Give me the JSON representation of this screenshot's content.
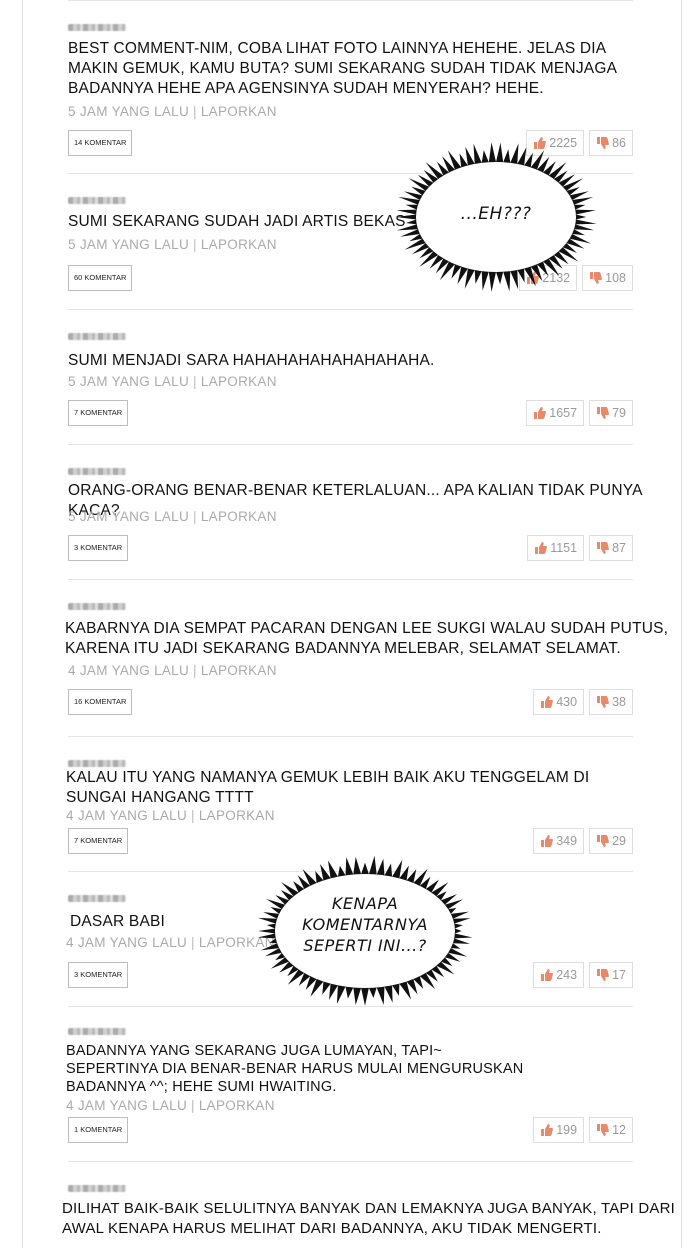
{
  "comments": [
    {
      "text": "BEST COMMENT-NIM, COBA LIHAT FOTO LAINNYA HEHEHE. JELAS DIA MAKIN GEMUK, KAMU BUTA? SUMI SEKARANG SUDAH TIDAK MENJAGA BADANNYA HEHE APA AGENSINYA SUDAH MENYERAH? HEHE.",
      "time": "5 JAM YANG LALU",
      "report": "LAPORKAN",
      "komentar": "14 KOMENTAR",
      "likes": "2225",
      "dislikes": "86"
    },
    {
      "text": "SUMI SEKARANG SUDAH JADI ARTIS BEKAS",
      "time": "5 JAM YANG LALU",
      "report": "LAPORKAN",
      "komentar": "60 KOMENTAR",
      "likes": "2132",
      "dislikes": "108"
    },
    {
      "text": "SUMI MENJADI SARA HAHAHAHAHAHAHAHAHA.",
      "time": "5 JAM YANG LALU",
      "report": "LAPORKAN",
      "komentar": "7 KOMENTAR",
      "likes": "1657",
      "dislikes": "79"
    },
    {
      "text": "ORANG-ORANG BENAR-BENAR KETERLALUAN... APA KALIAN TIDAK PUNYA KACA?",
      "time": "5 JAM YANG LALU",
      "report": "LAPORKAN",
      "komentar": "3 KOMENTAR",
      "likes": "1151",
      "dislikes": "87"
    },
    {
      "text": "KABARNYA DIA SEMPAT PACARAN DENGAN LEE SUKGI WALAU SUDAH PUTUS, KARENA ITU JADI SEKARANG BADANNYA MELEBAR, SELAMAT SELAMAT.",
      "time": "4 JAM YANG LALU",
      "report": "LAPORKAN",
      "komentar": "16 KOMENTAR",
      "likes": "430",
      "dislikes": "38"
    },
    {
      "text": "KALAU ITU YANG NAMANYA GEMUK LEBIH BAIK AKU TENGGELAM DI SUNGAI HANGANG TTTT",
      "time": "4 JAM YANG LALU",
      "report": "LAPORKAN",
      "komentar": "7 KOMENTAR",
      "likes": "349",
      "dislikes": "29"
    },
    {
      "text": "DASAR BABI",
      "time": "4 JAM YANG LALU",
      "report": "LAPORKAN",
      "komentar": "3 KOMENTAR",
      "likes": "243",
      "dislikes": "17"
    },
    {
      "text": "BADANNYA YANG SEKARANG JUGA LUMAYAN, TAPI~ SEPERTINYA DIA BENAR-BENAR HARUS MULAI MENGURUSKAN BADANNYA ^^; HEHE SUMI HWAITING.",
      "time": "4 JAM YANG LALU",
      "report": "LAPORKAN",
      "komentar": "1 KOMENTAR",
      "likes": "199",
      "dislikes": "12"
    },
    {
      "text": "DILIHAT BAIK-BAIK SELULITNYA BANYAK DAN LEMAKNYA JUGA BANYAK, TAPI DARI AWAL KENAPA HARUS MELIHAT DARI BADANNYA, AKU TIDAK MENGERTI."
    }
  ],
  "bubbles": [
    {
      "text": "...EH???"
    },
    {
      "line1": "KENAPA",
      "line2": "KOMENTARNYA",
      "line3": "SEPERTI INI...?"
    }
  ],
  "colors": {
    "meta": "#aaaaaa",
    "like": "#e8896c",
    "dislike": "#e8896c"
  }
}
